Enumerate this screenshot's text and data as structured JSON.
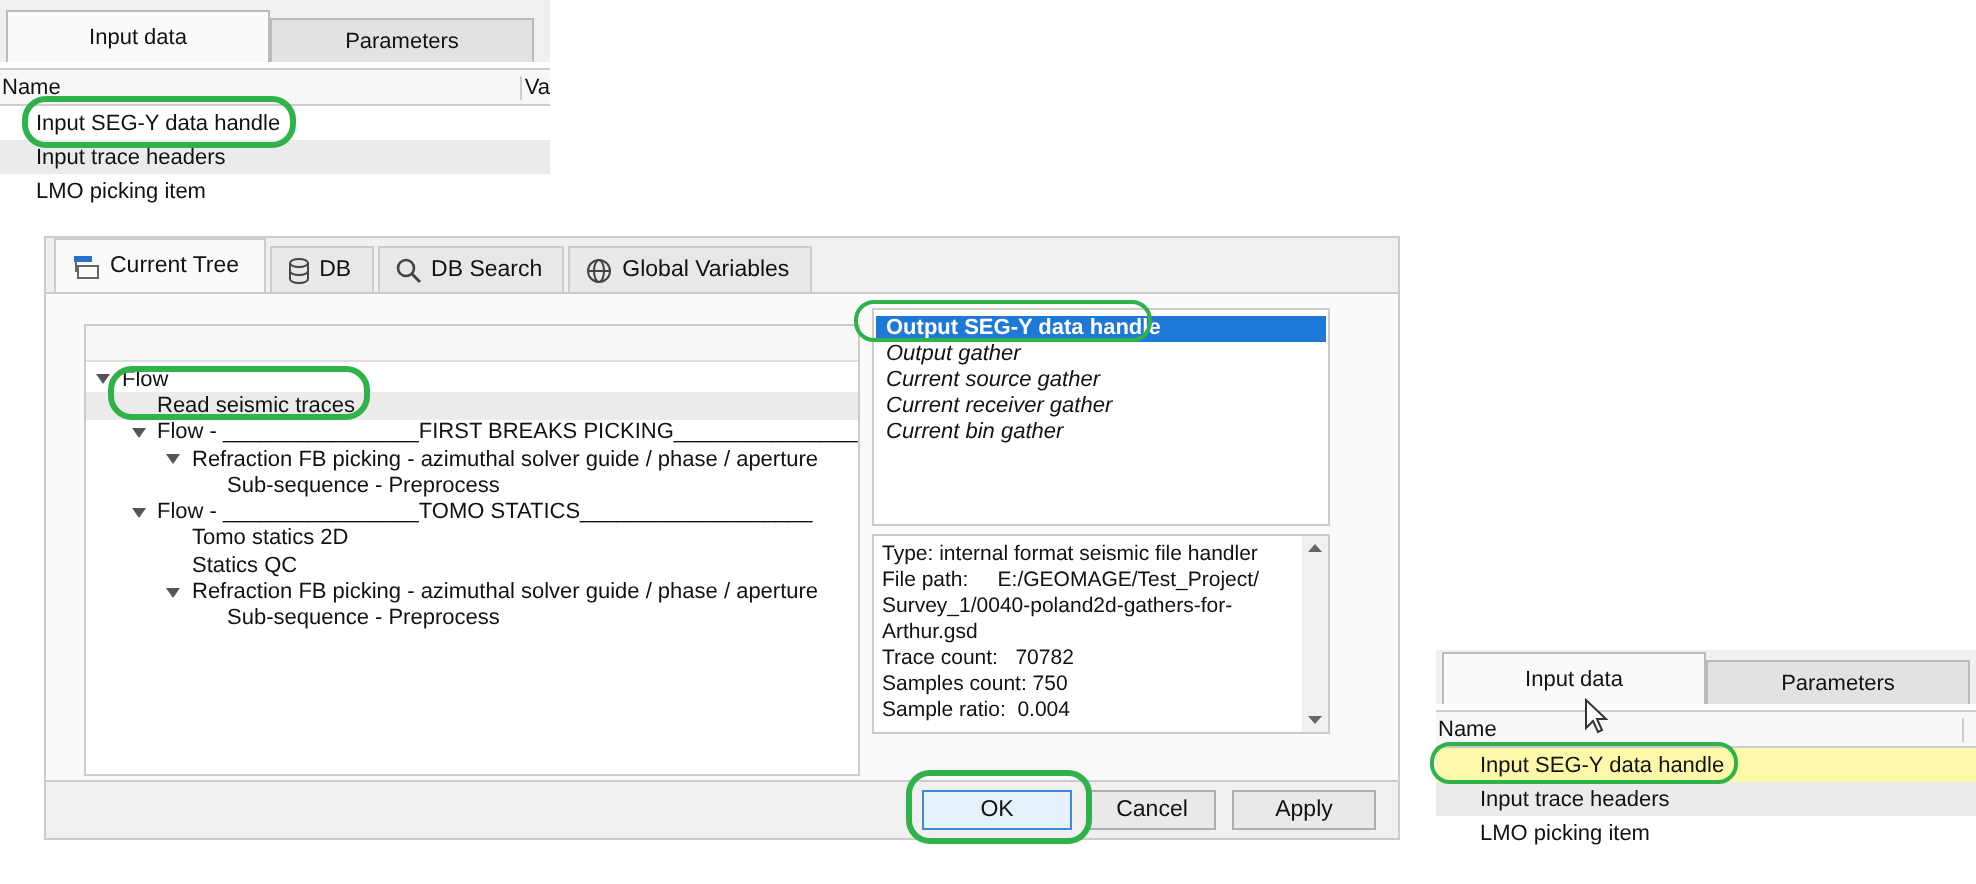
{
  "top_panel": {
    "tabs": [
      {
        "label": "Input data",
        "selected": true
      },
      {
        "label": "Parameters",
        "selected": false
      }
    ],
    "columns": [
      "Name",
      "Va"
    ],
    "rows": [
      {
        "label": "Input SEG-Y data handle",
        "selected": false,
        "highlighted": false
      },
      {
        "label": "Input trace headers",
        "selected": false,
        "highlighted": true
      },
      {
        "label": "LMO picking item",
        "selected": false,
        "highlighted": false
      }
    ]
  },
  "dialog": {
    "tabs": [
      {
        "label": "Current Tree",
        "selected": true
      },
      {
        "label": "DB",
        "selected": false
      },
      {
        "label": "DB Search",
        "selected": false
      },
      {
        "label": "Global Variables",
        "selected": false
      }
    ],
    "tree": [
      {
        "label": "Flow",
        "expanded": true,
        "highlighted": false,
        "children": [
          {
            "label": "Read seismic traces",
            "highlighted": true
          },
          {
            "label": "Flow - ________________FIRST BREAKS PICKING_______________",
            "expanded": true,
            "highlighted": false,
            "children": [
              {
                "label": "Refraction FB picking - azimuthal solver guide / phase / aperture",
                "expanded": true,
                "highlighted": false,
                "children": [
                  {
                    "label": "Sub-sequence - Preprocess",
                    "highlighted": false
                  }
                ]
              }
            ]
          },
          {
            "label": "Flow - ________________TOMO STATICS___________________",
            "expanded": true,
            "highlighted": false,
            "children": [
              {
                "label": "Tomo statics 2D",
                "highlighted": false
              },
              {
                "label": "Statics QC",
                "highlighted": false
              },
              {
                "label": "Refraction FB picking - azimuthal solver guide / phase / aperture",
                "expanded": true,
                "highlighted": false,
                "children": [
                  {
                    "label": "Sub-sequence - Preprocess",
                    "highlighted": false
                  }
                ]
              }
            ]
          }
        ]
      }
    ],
    "outputs": [
      {
        "label": "Output SEG-Y data handle",
        "selected": true
      },
      {
        "label": "Output gather",
        "selected": false
      },
      {
        "label": "Current source gather",
        "selected": false
      },
      {
        "label": "Current receiver gather",
        "selected": false
      },
      {
        "label": "Current bin gather",
        "selected": false
      }
    ],
    "info": [
      "Type: internal format seismic file handler",
      "File path:     E:/GEOMAGE/Test_Project/ Survey_1/0040-poland2d-gathers-for-Arthur.gsd",
      "Trace count:   70782",
      "Samples count: 750",
      "Sample ratio:  0.004"
    ],
    "buttons": [
      {
        "label": "OK",
        "default": true
      },
      {
        "label": "Cancel",
        "default": false
      },
      {
        "label": "Apply",
        "default": false
      }
    ]
  },
  "bottom_panel": {
    "tabs": [
      {
        "label": "Input data",
        "selected": true
      },
      {
        "label": "Parameters",
        "selected": false
      }
    ],
    "columns": [
      "Name"
    ],
    "rows": [
      {
        "label": "Input SEG-Y data handle",
        "selected": true,
        "highlighted": false
      },
      {
        "label": "Input trace headers",
        "selected": false,
        "highlighted": true
      },
      {
        "label": "LMO picking item",
        "selected": false,
        "highlighted": false
      }
    ]
  }
}
